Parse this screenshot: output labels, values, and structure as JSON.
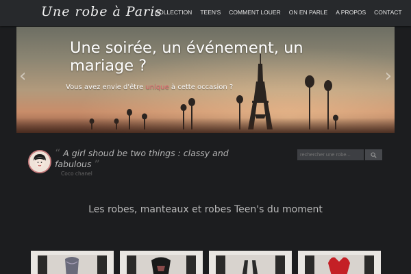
{
  "header": {
    "logo": "Une robe à Paris",
    "nav": [
      "COLLECTION",
      "TEEN'S",
      "COMMENT LOUER",
      "ON EN PARLE",
      "A PROPOS",
      "CONTACT"
    ]
  },
  "hero": {
    "title": "Une soirée, un événement, un mariage ?",
    "subtitle_before": "Vous avez envie d'être ",
    "subtitle_highlight": "unique",
    "subtitle_after": " à cette occasion ?",
    "prev_arrow": "‹",
    "next_arrow": "›"
  },
  "quote": {
    "open_mark": "“",
    "text": "A girl shoud be two things : classy and fabulous",
    "close_mark": "”",
    "author": "Coco chanel"
  },
  "search": {
    "placeholder": "rechercher une robe..."
  },
  "section": {
    "title": "Les robes, manteaux et robes Teen's du moment"
  },
  "products": [
    {
      "dress_color": "#6a6a7a"
    },
    {
      "dress_color": "#1a1a1a"
    },
    {
      "dress_color": "#2a2a2a"
    },
    {
      "dress_color": "#c42026"
    }
  ],
  "colors": {
    "accent": "#e26a72",
    "header_bg": "#27292c",
    "page_bg": "#1c1d1f"
  }
}
